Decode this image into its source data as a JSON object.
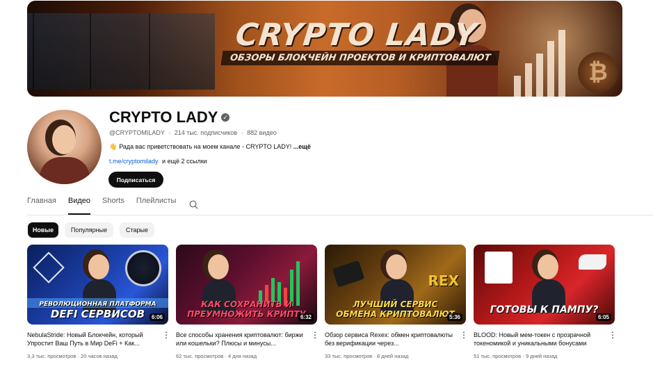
{
  "banner": {
    "title": "CRYPTO LADY",
    "subtitle": "ОБЗОРЫ БЛОКЧЕЙН ПРОЕКТОВ И КРИПТОВАЛЮТ"
  },
  "channel": {
    "name": "CRYPTO LADY",
    "verified_icon": "✓",
    "handle": "@CRYPTOMILADY",
    "subscribers": "214 тыс. подписчиков",
    "video_count": "882 видео",
    "separator": "·",
    "description": "Рада вас приветствовать на моем канале - CRYPTO LADY!",
    "description_more": "...ещё",
    "link": "t.me/cryptomilady",
    "more_links": "и ещё 2 ссылки",
    "subscribe_label": "Подписаться"
  },
  "tabs": [
    {
      "label": "Главная",
      "active": false
    },
    {
      "label": "Видео",
      "active": true
    },
    {
      "label": "Shorts",
      "active": false
    },
    {
      "label": "Плейлисты",
      "active": false
    }
  ],
  "chips": [
    {
      "label": "Новые",
      "active": true
    },
    {
      "label": "Популярные",
      "active": false
    },
    {
      "label": "Старые",
      "active": false
    }
  ],
  "videos": [
    {
      "thumb_caption_1": "Революционная платформа",
      "thumb_caption_2": "DEFI СЕРВИСОВ",
      "duration": "6:06",
      "title": "NebulaStride: Новый Блокчейн, который Упростит Ваш Путь в Мир DeFi + Как...",
      "views": "3,3 тыс. просмотров",
      "age": "20 часов назад"
    },
    {
      "thumb_caption_1": "КАК СОХРАНИТЬ И",
      "thumb_caption_2": "ПРЕУМНОЖИТЬ КРИПТУ",
      "duration": "6:32",
      "title": "Все способы хранения криптовалют: биржи или кошельки? Плюсы и минусы...",
      "views": "62 тыс. просмотров",
      "age": "4 дня назад"
    },
    {
      "thumb_caption_1": "ЛУЧШИЙ СЕРВИС",
      "thumb_caption_2": "ОБМЕНА КРИПТОВАЛЮТ",
      "duration": "5:36",
      "title": "Обзор сервиса Rexex: обмен криптовалюты без верификации через...",
      "views": "33 тыс. просмотров",
      "age": "8 дней назад"
    },
    {
      "thumb_caption_1": "ГОТОВЫ К ПАМПУ?",
      "thumb_caption_2": "",
      "duration": "6:05",
      "title": "BLOOD: Новый мем-токен с прозрачной токеномикой и уникальными бонусами",
      "views": "51 тыс. просмотров",
      "age": "9 дней назад"
    }
  ],
  "thumb_marks": {
    "rex": "REX",
    "coin": "₿"
  },
  "kebab": "⋮"
}
